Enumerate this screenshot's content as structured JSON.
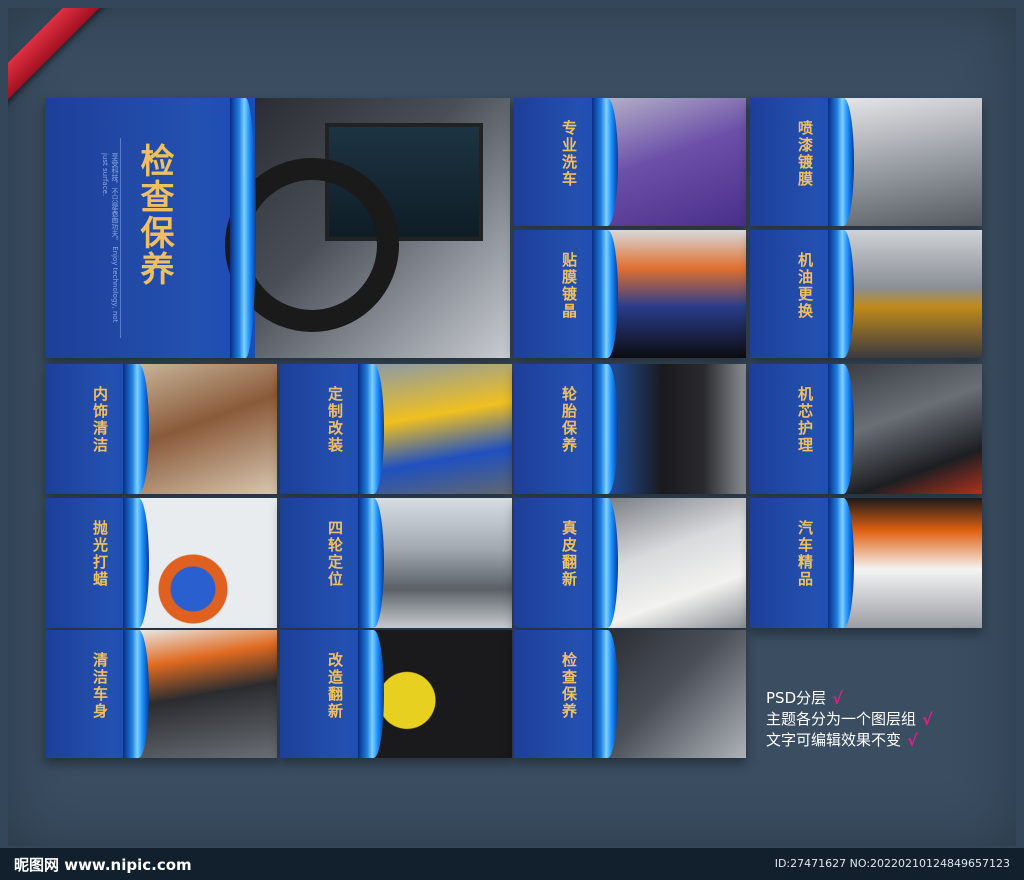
{
  "cards": [
    {
      "title": "检查保养",
      "subtitle": "享受科技，不只是表面功夫。 Enjoy technology, not just surface."
    },
    {
      "title": "专业洗车"
    },
    {
      "title": "喷漆镀膜"
    },
    {
      "title": "贴膜镀晶"
    },
    {
      "title": "机油更换"
    },
    {
      "title": "内饰清洁"
    },
    {
      "title": "定制改装"
    },
    {
      "title": "轮胎保养"
    },
    {
      "title": "机芯护理"
    },
    {
      "title": "抛光打蜡"
    },
    {
      "title": "四轮定位"
    },
    {
      "title": "真皮翻新"
    },
    {
      "title": "汽车精品"
    },
    {
      "title": "清洁车身"
    },
    {
      "title": "改造翻新"
    },
    {
      "title": "检查保养"
    }
  ],
  "notes": [
    "PSD分层",
    "主题各分为一个图层组",
    "文字可编辑效果不变"
  ],
  "check_mark": "√",
  "footer": {
    "logo": "昵图网 www.nipic.com",
    "id": "ID:27471627 NO:20220210124849657123"
  },
  "colors": {
    "background": "#34475a",
    "card_blue": "#1a3f9a",
    "title_gold": "#f0c060",
    "check_pink": "#e0208a"
  },
  "icon_names": [
    "ribbon-corner-icon",
    "check-icon"
  ]
}
